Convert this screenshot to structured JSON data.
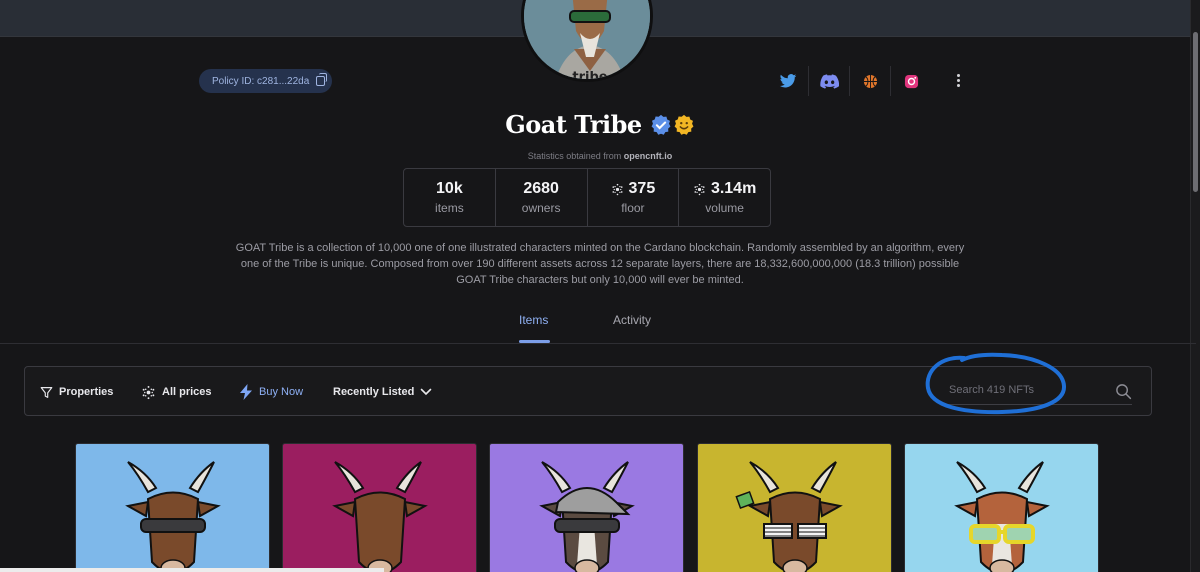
{
  "collection": {
    "name": "Goat Tribe",
    "policy_id": "Policy ID: c281...22da",
    "stats_source_prefix": "Statistics obtained from",
    "stats_source": "opencnft.io",
    "stats": [
      {
        "value": "10k",
        "label": "items",
        "ada": false
      },
      {
        "value": "2680",
        "label": "owners",
        "ada": false
      },
      {
        "value": "375",
        "label": "floor",
        "ada": true
      },
      {
        "value": "3.14m",
        "label": "volume",
        "ada": true
      }
    ],
    "description_lines": [
      "GOAT Tribe is a collection of 10,000 one of one illustrated characters minted on the Cardano blockchain. Randomly assembled by an algorithm, every",
      "one of the Tribe is unique. Composed from over 190 different assets across 12 separate layers, there are 18,332,600,000,000 (18.3 trillion) possible",
      "GOAT Tribe characters but only 10,000 will ever be minted."
    ]
  },
  "social": [
    "twitter-icon",
    "discord-icon",
    "basketball-icon",
    "instagram-icon"
  ],
  "tabs": [
    {
      "label": "Items",
      "active": true
    },
    {
      "label": "Activity",
      "active": false
    }
  ],
  "toolbar": {
    "properties": "Properties",
    "prices": "All prices",
    "buy_now": "Buy Now",
    "sort": "Recently Listed",
    "search_placeholder": "Search 419 NFTs"
  },
  "cards": [
    {
      "bg": "#7eb8ea",
      "accessory": "bandana"
    },
    {
      "bg": "#9b1e60",
      "accessory": "none"
    },
    {
      "bg": "#9a79e2",
      "accessory": "cap-bandana"
    },
    {
      "bg": "#c8b52f",
      "accessory": "shutter-shades"
    },
    {
      "bg": "#96d6ee",
      "accessory": "yellow-sunglasses"
    }
  ],
  "colors": {
    "accent": "#7c9ee8",
    "annotation": "#1f6fd6",
    "background": "#161618"
  }
}
